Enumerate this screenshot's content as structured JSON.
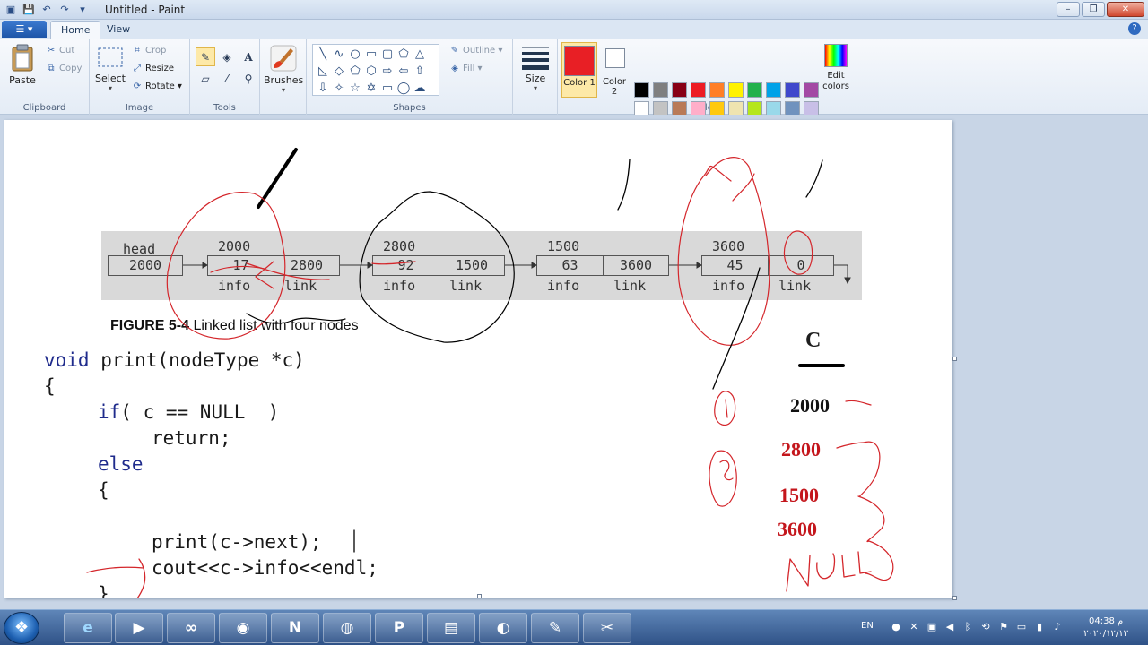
{
  "window": {
    "title": "Untitled - Paint"
  },
  "tabs": [
    {
      "label": "Home"
    },
    {
      "label": "View"
    }
  ],
  "ribbon": {
    "clipboard": {
      "label": "Clipboard",
      "paste": "Paste",
      "cut": "Cut",
      "copy": "Copy"
    },
    "image": {
      "label": "Image",
      "select": "Select",
      "crop": "Crop",
      "resize": "Resize",
      "rotate": "Rotate"
    },
    "tools": {
      "label": "Tools"
    },
    "brushes": {
      "label": "Brushes"
    },
    "shapes": {
      "label": "Shapes",
      "outline": "Outline",
      "fill": "Fill"
    },
    "size": {
      "label": "Size"
    },
    "colors": {
      "label": "Colors",
      "color1": "Color 1",
      "color2": "Color 2",
      "edit": "Edit colors",
      "color1_value": "#e81f25",
      "color2_value": "#ffffff",
      "palette": [
        "#000000",
        "#7f7f7f",
        "#880015",
        "#ed1c24",
        "#ff7f27",
        "#fff200",
        "#22b14c",
        "#00a2e8",
        "#3f48cc",
        "#a349a4",
        "#ffffff",
        "#c3c3c3",
        "#b97a57",
        "#ffaec9",
        "#ffc90e",
        "#efe4b0",
        "#b5e61d",
        "#99d9ea",
        "#7092be",
        "#c8bfe7",
        "#ffffff",
        "#ffffff",
        "#ffffff",
        "#ffffff",
        "#ffffff",
        "#ffffff",
        "#ffffff",
        "#ffffff",
        "#ffffff",
        "#ffffff"
      ]
    }
  },
  "canvas": {
    "figure": {
      "head_label": "head",
      "head_value": "2000",
      "nodes": [
        {
          "addr": "2000",
          "info": "17",
          "link": "2800"
        },
        {
          "addr": "2800",
          "info": "92",
          "link": "1500"
        },
        {
          "addr": "1500",
          "info": "63",
          "link": "3600"
        },
        {
          "addr": "3600",
          "info": "45",
          "link": "0"
        }
      ],
      "info_label": "info",
      "link_label": "link",
      "caption_bold": "FIGURE 5-4",
      "caption_text": " Linked list with four nodes"
    },
    "code": {
      "l1a": "void",
      "l1b": " print(nodeType *c)",
      "l2": "{",
      "l3a": "if",
      "l3b": "( c == NULL  )",
      "l4": "return;",
      "l5": "else",
      "l6": "{",
      "l7": "print(c->next);",
      "l8": "cout<<c->info<<endl;",
      "l9": "}"
    },
    "side": {
      "c_label": "C",
      "v1": "2000",
      "v2": "2800",
      "v3": "1500",
      "v4": "3600",
      "null_text": "NULL",
      "mark1": "1",
      "mark2": "2"
    }
  },
  "taskbar": {
    "lang": "EN",
    "time": "04:38 م",
    "date": "٢٠٢٠/١٢/١٣"
  }
}
